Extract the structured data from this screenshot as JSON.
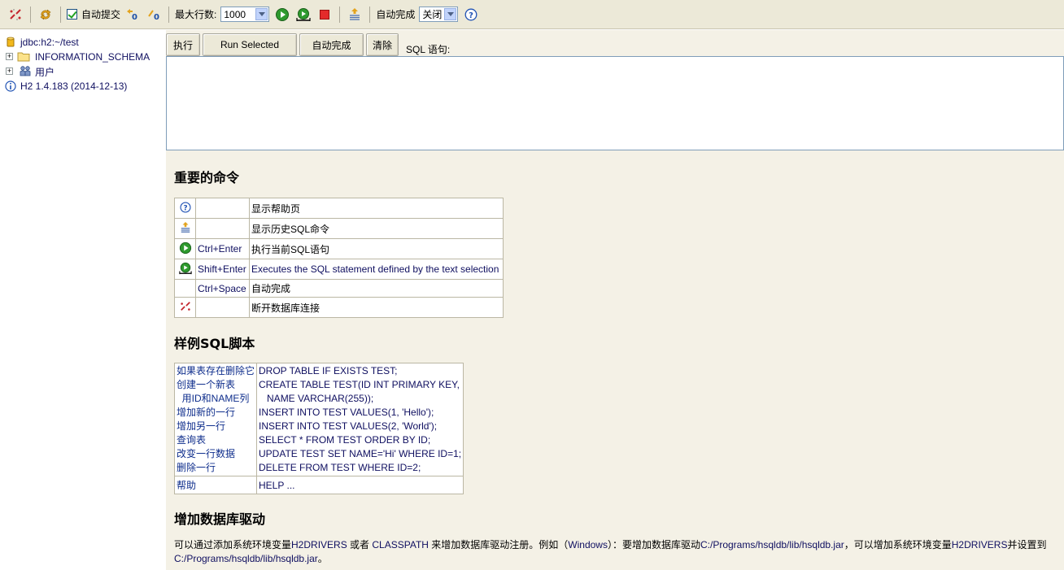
{
  "toolbar": {
    "autocommit_label": "自动提交",
    "autocommit_checked": true,
    "maxrows_label": "最大行数:",
    "maxrows_value": "1000",
    "autocomplete_label": "自动完成",
    "autocomplete_value": "关闭",
    "icons": [
      "disconnect-icon",
      "refresh-icon",
      "autocommit-checkbox",
      "commit-icon",
      "rollback-icon",
      "run-icon",
      "run-selected-icon",
      "stop-icon",
      "history-icon",
      "help-icon"
    ]
  },
  "tree": {
    "connection": "jdbc:h2:~/test",
    "items": [
      {
        "label": "INFORMATION_SCHEMA",
        "icon": "folder-icon"
      },
      {
        "label": "用户",
        "icon": "users-icon"
      }
    ],
    "version": "H2 1.4.183 (2014-12-13)"
  },
  "query": {
    "buttons": [
      "执行",
      "Run Selected",
      "自动完成",
      "清除"
    ],
    "sql_label": "SQL 语句:",
    "sql_value": ""
  },
  "help": {
    "commands_title": "重要的命令",
    "commands": [
      {
        "icon": "help-icon",
        "key": "",
        "desc": "显示帮助页"
      },
      {
        "icon": "history-icon",
        "key": "",
        "desc": "显示历史SQL命令"
      },
      {
        "icon": "run-icon",
        "key": "Ctrl+Enter",
        "desc": "执行当前SQL语句"
      },
      {
        "icon": "run-selected-icon",
        "key": "Shift+Enter",
        "desc": "Executes the SQL statement defined by the text selection"
      },
      {
        "icon": "",
        "key": "Ctrl+Space",
        "desc": "自动完成"
      },
      {
        "icon": "disconnect-icon",
        "key": "",
        "desc": "断开数据库连接"
      }
    ],
    "samples_title": "样例SQL脚本",
    "samples": [
      {
        "label": "如果表存在删除它",
        "sql": "DROP TABLE IF EXISTS TEST;"
      },
      {
        "label": "创建一个新表",
        "sql": "CREATE TABLE TEST(ID INT PRIMARY KEY,"
      },
      {
        "label": "  用ID和NAME列",
        "sql": "   NAME VARCHAR(255));"
      },
      {
        "label": "增加新的一行",
        "sql": "INSERT INTO TEST VALUES(1, 'Hello');"
      },
      {
        "label": "增加另一行",
        "sql": "INSERT INTO TEST VALUES(2, 'World');"
      },
      {
        "label": "查询表",
        "sql": "SELECT * FROM TEST ORDER BY ID;"
      },
      {
        "label": "改变一行数据",
        "sql": "UPDATE TEST SET NAME='Hi' WHERE ID=1;"
      },
      {
        "label": "删除一行",
        "sql": "DELETE FROM TEST WHERE ID=2;"
      }
    ],
    "help_label": "帮助",
    "help_sql": "HELP ...",
    "driver_title": "增加数据库驱动",
    "driver_p1": "可以通过添加系统环境变量",
    "driver_var1": "H2DRIVERS",
    "driver_p2": " 或者 ",
    "driver_var2": "CLASSPATH",
    "driver_p3": " 来增加数据库驱动注册。例如（",
    "driver_os": "Windows",
    "driver_p4": "）：要增加数据库驱动",
    "driver_path1": "C:/Programs/hsqldb/lib/hsqldb.jar",
    "driver_p5": "，可以增加系统环境变量",
    "driver_var3": "H2DRIVERS",
    "driver_p6": "并设置到",
    "driver_path2": "C:/Programs/hsqldb/lib/hsqldb.jar",
    "driver_p7": "。"
  }
}
